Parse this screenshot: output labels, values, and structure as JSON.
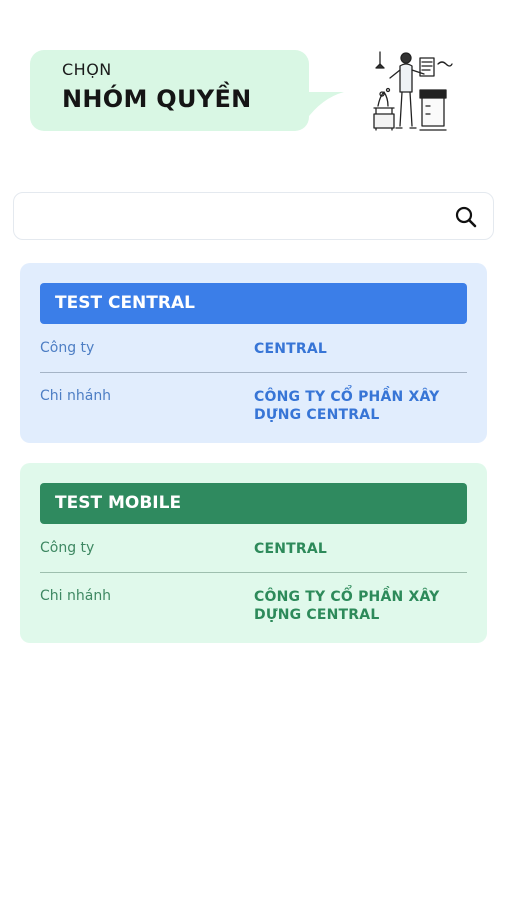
{
  "header": {
    "line1": "CHỌN",
    "line2": "NHÓM QUYỀN"
  },
  "search": {
    "placeholder": "",
    "value": ""
  },
  "groups": [
    {
      "title": "TEST CENTRAL",
      "company_label": "Công ty",
      "company_value": "CENTRAL",
      "branch_label": "Chi nhánh",
      "branch_value": "CÔNG TY CỔ PHẦN XÂY DỰNG CENTRAL",
      "color": "#3b7ee8"
    },
    {
      "title": "TEST MOBILE",
      "company_label": "Công ty",
      "company_value": "CENTRAL",
      "branch_label": "Chi nhánh",
      "branch_value": "CÔNG TY CỔ PHẦN XÂY DỰNG CENTRAL",
      "color": "#2f8a5f"
    }
  ],
  "icons": {
    "search": "search-icon",
    "illustration": "person-working-illustration"
  }
}
